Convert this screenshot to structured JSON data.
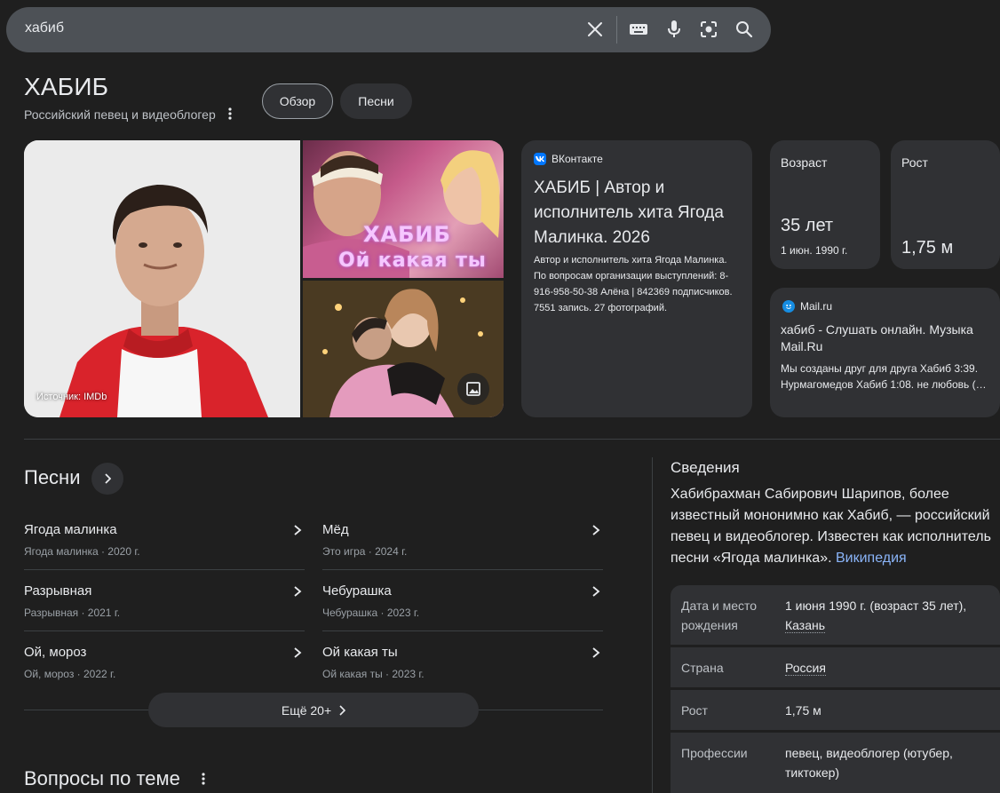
{
  "search": {
    "query": "хабиб"
  },
  "entity": {
    "title": "ХАБИБ",
    "subtitle": "Российский певец и видеоблогер"
  },
  "chips": {
    "overview": "Обзор",
    "songs": "Песни"
  },
  "images": {
    "source_label": "Источник: IMDb",
    "top_overlay_line1": "ХАБИБ",
    "top_overlay_line2": "Ой какая ты"
  },
  "vk_card": {
    "source": "ВКонтакте",
    "title": "ХАБИБ | Автор и исполнитель хита Ягода Малинка. 2026",
    "description": "Автор и исполнитель хита Ягода Малинка. По вопросам организации выступлений: 8-916-958-50-38 Алёна | 842369 подписчиков. 7551 запись. 27 фотографий."
  },
  "age_card": {
    "label": "Возраст",
    "value": "35 лет",
    "sub": "1 июн. 1990 г."
  },
  "height_card": {
    "label": "Рост",
    "value": "1,75 м"
  },
  "mail_card": {
    "source": "Mail.ru",
    "title": "хабиб - Слушать онлайн. Музыка Mail.Ru",
    "description": "Мы созданы друг для друга Хабиб 3:39. Нурмагомедов Хабиб 1:08. не любовь (…"
  },
  "songs": {
    "title": "Песни",
    "items": [
      {
        "name": "Ягода малинка",
        "meta": "Ягода малинка · 2020 г."
      },
      {
        "name": "Мёд",
        "meta": "Это игра · 2024 г."
      },
      {
        "name": "Разрывная",
        "meta": "Разрывная · 2021 г."
      },
      {
        "name": "Чебурашка",
        "meta": "Чебурашка · 2023 г."
      },
      {
        "name": "Ой, мороз",
        "meta": "Ой, мороз · 2022 г."
      },
      {
        "name": "Ой какая ты",
        "meta": "Ой какая ты · 2023 г."
      }
    ],
    "more_label": "Ещё 20+"
  },
  "questions": {
    "title": "Вопросы по теме"
  },
  "info": {
    "title": "Сведения",
    "description": "Хабибрахман Сабирович Шарипов, более известный мононимно как Хабиб, — российский певец и видеоблогер. Известен как исполнитель песни «Ягода малинка».",
    "wiki_link": "Википедия",
    "facts": {
      "birth_label": "Дата и место рождения",
      "birth_value": "1 июня 1990 г. (возраст 35 лет),",
      "birth_place": "Казань",
      "country_label": "Страна",
      "country_value": "Россия",
      "height_label": "Рост",
      "height_value": "1,75 м",
      "prof_label": "Профессии",
      "prof_value": "певец, видеоблогер (ютубер, тиктокер)"
    }
  },
  "colors": {
    "background": "#1f1f1f",
    "card": "#303134",
    "searchbar": "#4d5156",
    "link": "#8ab4f8",
    "vk_brand": "#0077ff",
    "mail_brand": "#168de2"
  },
  "icons": {
    "clear": "close-icon",
    "keyboard": "keyboard-icon",
    "voice": "microphone-icon",
    "lens": "lens-icon",
    "search": "search-icon"
  }
}
